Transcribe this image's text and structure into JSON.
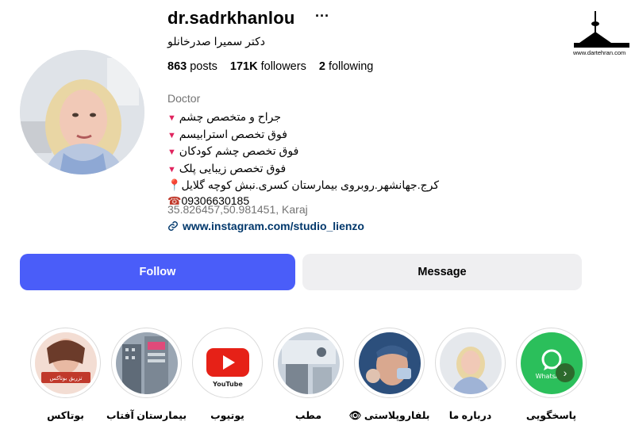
{
  "profile": {
    "username": "dr.sadrkhanlou",
    "more_label": "···",
    "full_name": "دکتر سمیرا صدرخانلو",
    "stats": {
      "posts_count": "863",
      "posts_label": "posts",
      "followers_count": "171K",
      "followers_label": "followers",
      "following_count": "2",
      "following_label": "following"
    },
    "category": "Doctor",
    "bio_lines": [
      "جراح و متخصص چشم",
      "فوق تخصص استرابیسم",
      "فوق تخصص چشم کودکان",
      "فوق تخصص زیبایی پلک"
    ],
    "bio_marker": "▼",
    "address": "کرج.جهانشهر.روبروی بیمارستان کسری.نبش کوچه گلایل",
    "phone": "09306630185",
    "location": "35.826457,50.981451, Karaj",
    "link": "www.instagram.com/studio_lienzo"
  },
  "actions": {
    "follow_label": "Follow",
    "message_label": "Message"
  },
  "highlights": [
    {
      "label": "بوتاکس",
      "thumb_text": "تزریق بوتاکس"
    },
    {
      "label": "بیمارستان آفتاب",
      "thumb_text": ""
    },
    {
      "label": "یوتیوب",
      "thumb_text": "YouTube"
    },
    {
      "label": "مطب",
      "thumb_text": ""
    },
    {
      "label": "بلفاروپلاستی 👁",
      "thumb_text": ""
    },
    {
      "label": "درباره ما",
      "thumb_text": ""
    },
    {
      "label": "پاسخگویی",
      "thumb_text": "WhatsApp"
    }
  ],
  "watermark": {
    "url": "www.dartehran.com"
  },
  "colors": {
    "follow_button": "#4a5df9",
    "message_button": "#efeff1",
    "link": "#00376b",
    "muted": "#737373",
    "marker": "#e0245e"
  }
}
